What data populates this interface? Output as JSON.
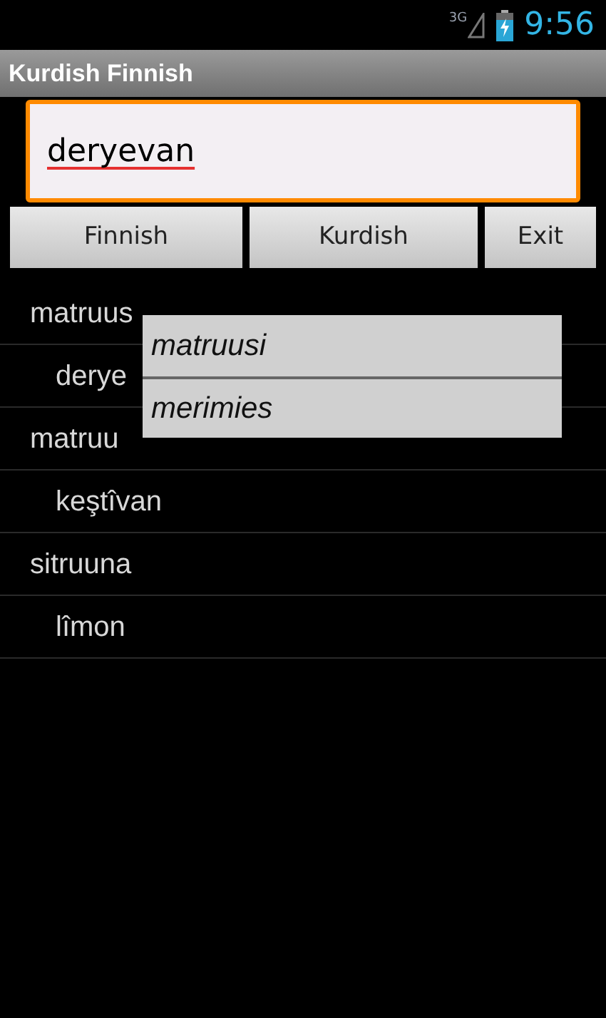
{
  "status_bar": {
    "network": "3G",
    "time": "9:56"
  },
  "window": {
    "title": "Kurdish Finnish"
  },
  "search": {
    "value": "deryevan"
  },
  "buttons": [
    {
      "label": "Finnish"
    },
    {
      "label": "Kurdish"
    },
    {
      "label": "Exit"
    }
  ],
  "results": [
    {
      "text": "matruus",
      "children": [
        {
          "text": "derye"
        }
      ]
    },
    {
      "text": "matruu",
      "children": [
        {
          "text": "keştîvan"
        }
      ]
    },
    {
      "text": "sitruuna",
      "children": [
        {
          "text": "lîmon"
        }
      ]
    }
  ],
  "suggestions": [
    "matruusi",
    "merimies"
  ]
}
